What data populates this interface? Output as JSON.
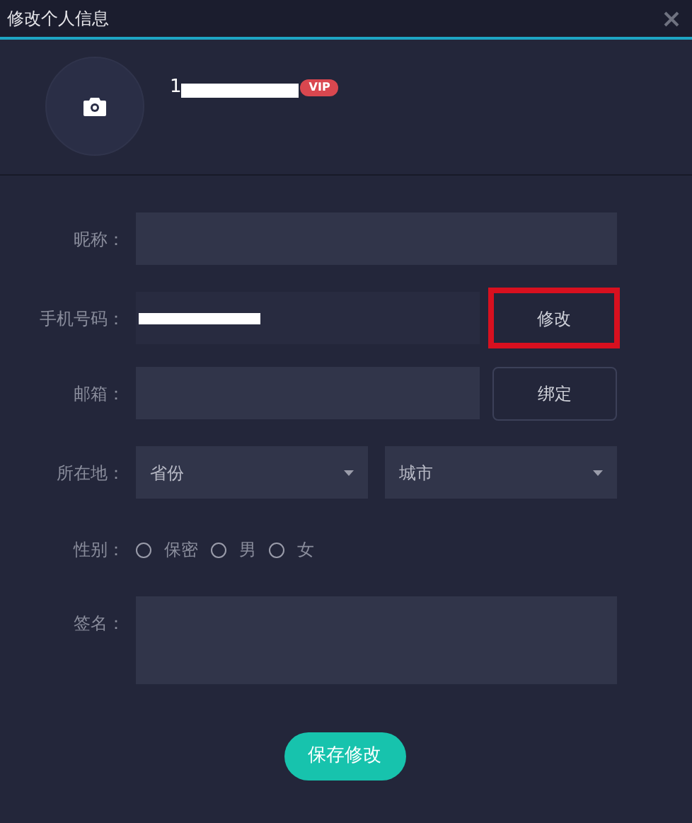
{
  "window": {
    "title": "修改个人信息"
  },
  "profile": {
    "username_visible": "1",
    "vip_badge": "VIP"
  },
  "form": {
    "nickname": {
      "label": "昵称："
    },
    "phone": {
      "label": "手机号码：",
      "button": "修改",
      "button_highlighted": true
    },
    "email": {
      "label": "邮箱：",
      "button": "绑定"
    },
    "location": {
      "label": "所在地：",
      "selects": [
        {
          "placeholder": "省份"
        },
        {
          "placeholder": "城市"
        }
      ]
    },
    "gender": {
      "label": "性别：",
      "options": [
        {
          "label": "保密",
          "selected": false
        },
        {
          "label": "男",
          "selected": false
        },
        {
          "label": "女",
          "selected": false
        }
      ]
    },
    "signature": {
      "label": "签名："
    }
  },
  "save_button": "保存修改"
}
